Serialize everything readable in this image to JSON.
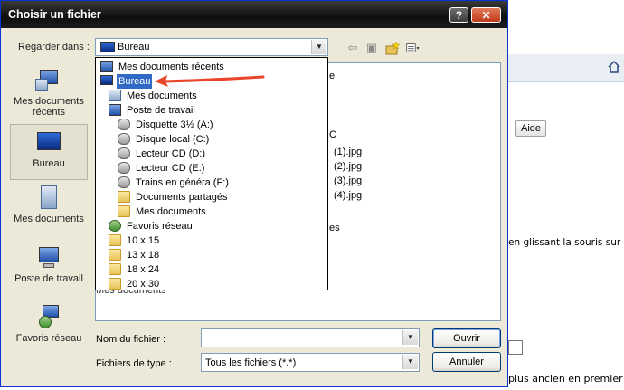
{
  "background": {
    "aide_label": "Aide",
    "partial_text": "en glissant la souris sur",
    "sort_text": "plus ancien en premier"
  },
  "dialog": {
    "title": "Choisir un fichier",
    "help_button": "?",
    "close_button": "✕",
    "lookin_label": "Regarder dans :",
    "lookin_value": "Bureau",
    "places": [
      "Mes documents récents",
      "Bureau",
      "Mes documents",
      "Poste de travail",
      "Favoris réseau"
    ],
    "dropdown_items": [
      {
        "label": "Mes documents récents",
        "icon": "recent-docs-icon"
      },
      {
        "label": "Bureau",
        "icon": "desktop-icon"
      },
      {
        "label": "Mes documents",
        "icon": "my-documents-icon"
      },
      {
        "label": "Poste de travail",
        "icon": "computer-icon"
      },
      {
        "label": "Disquette 3½ (A:)",
        "icon": "floppy-drive-icon"
      },
      {
        "label": "Disque local (C:)",
        "icon": "hard-drive-icon"
      },
      {
        "label": "Lecteur CD (D:)",
        "icon": "cd-drive-icon"
      },
      {
        "label": "Lecteur CD (E:)",
        "icon": "cd-drive-icon"
      },
      {
        "label": "Trains en généra (F:)",
        "icon": "drive-icon"
      },
      {
        "label": "Documents partagés",
        "icon": "folder-icon"
      },
      {
        "label": "Mes documents",
        "icon": "folder-icon"
      },
      {
        "label": "Favoris réseau",
        "icon": "network-icon"
      },
      {
        "label": "10 x 15",
        "icon": "folder-icon"
      },
      {
        "label": "13 x 18",
        "icon": "folder-icon"
      },
      {
        "label": "18 x 24",
        "icon": "folder-icon"
      },
      {
        "label": "20 x 30",
        "icon": "folder-icon"
      }
    ],
    "file_list_partial": [
      "e",
      "C",
      "(1).jpg",
      "(2).jpg",
      "(3).jpg",
      "(4).jpg",
      "es",
      "Mes documents"
    ],
    "filename_label": "Nom du fichier :",
    "filename_value": "",
    "filetype_label": "Fichiers de type :",
    "filetype_value": "Tous les fichiers (*.*)",
    "open_button": "Ouvrir",
    "cancel_button": "Annuler"
  }
}
